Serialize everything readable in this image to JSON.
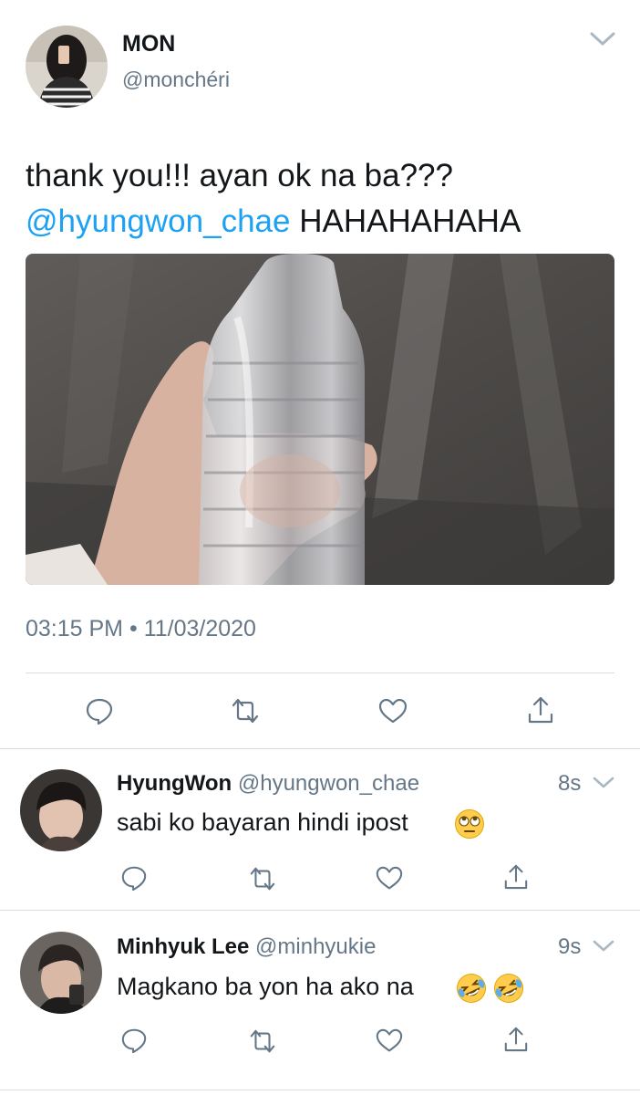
{
  "tweet": {
    "display_name": "MON",
    "handle": "@monchéri",
    "text_line1": "thank you!!! ayan ok na ba???",
    "mention": "@hyungwon_chae",
    "text_after_mention": "HAHAHAHAHA",
    "time": "03:15 PM",
    "separator": "•",
    "date": "11/03/2020"
  },
  "replies": [
    {
      "display_name": "HyungWon",
      "handle": "@hyungwon_chae",
      "age": "8s",
      "text": "sabi ko bayaran hindi ipost",
      "emojis": [
        "face-with-rolling-eyes"
      ]
    },
    {
      "display_name": "Minhyuk Lee",
      "handle": "@minhyukie",
      "age": "9s",
      "text": "Magkano ba yon ha ako na",
      "emojis": [
        "rolling-on-the-floor-laughing",
        "rolling-on-the-floor-laughing"
      ]
    }
  ],
  "colors": {
    "link": "#1da1f2",
    "secondary": "#657786",
    "divider": "#d9dde1",
    "text": "#14171a"
  },
  "icons": [
    "chevron-down-icon",
    "reply-icon",
    "retweet-icon",
    "like-icon",
    "share-icon"
  ]
}
